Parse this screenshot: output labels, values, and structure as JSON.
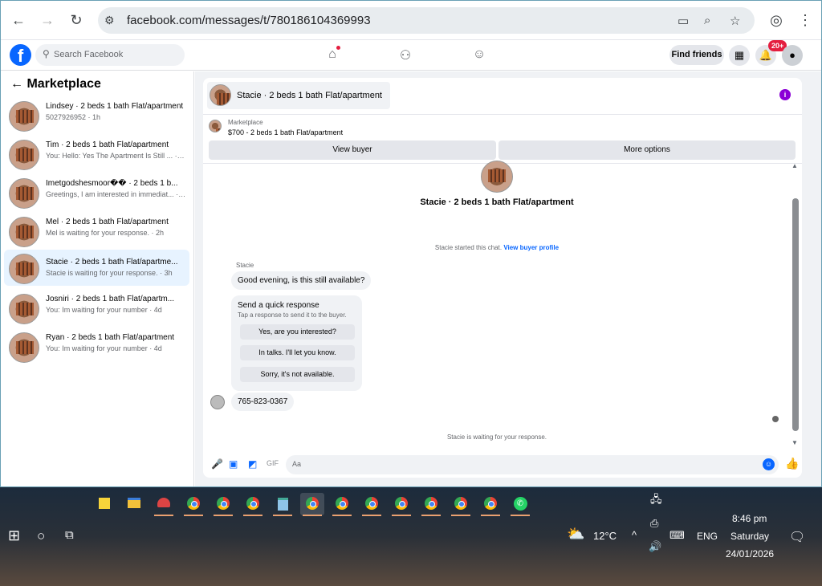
{
  "browser": {
    "url": "facebook.com/messages/t/780186104369993"
  },
  "header": {
    "logo": "f",
    "search_placeholder": "Search Facebook",
    "find_friends": "Find friends",
    "notif_badge": "20+"
  },
  "sidebar": {
    "title": "Marketplace",
    "items": [
      {
        "name": "Lindsey · 2 beds 1 bath Flat/apartment",
        "snippet": "5027926952 · 1h"
      },
      {
        "name": "Tim · 2 beds 1 bath Flat/apartment",
        "snippet": "You: Hello: Yes The Apartment Is Still ... · 1h"
      },
      {
        "name": "Imetgodshesmoor�� · 2 beds 1 b...",
        "snippet": "Greetings, I am interested in immediat... · 2h"
      },
      {
        "name": "Mel · 2 beds 1 bath Flat/apartment",
        "snippet": "Mel is waiting for your response. · 2h"
      },
      {
        "name": "Stacie · 2 beds 1 bath Flat/apartme...",
        "snippet": "Stacie is waiting for your response. · 3h"
      },
      {
        "name": "Josniri · 2 beds 1 bath Flat/apartm...",
        "snippet": "You: Im waiting for your number · 4d"
      },
      {
        "name": "Ryan · 2 beds 1 bath Flat/apartment",
        "snippet": "You: Im waiting for your number · 4d"
      }
    ]
  },
  "chat": {
    "title": "Stacie · 2 beds 1 bath Flat/apartment",
    "marketplace_label": "Marketplace",
    "listing": "$700 - 2 beds 1 bath Flat/apartment",
    "view_buyer": "View buyer",
    "more_options": "More options",
    "center_name": "Stacie · 2 beds 1 bath Flat/apartment",
    "started_text": "Stacie started this chat.",
    "view_profile": "View buyer profile",
    "sender": "Stacie",
    "message1": "Good evening, is this still available?",
    "quick_title": "Send a quick response",
    "quick_sub": "Tap a response to send it to the buyer.",
    "quick_1": "Yes, are you interested?",
    "quick_2": "In talks. I'll let you know.",
    "quick_3": "Sorry, it's not available.",
    "message2": "765-823-0367",
    "waiting": "Stacie is waiting for your response.",
    "input_placeholder": "Aa"
  },
  "taskbar": {
    "temp": "12°C",
    "lang": "ENG",
    "time": "8:46 pm",
    "day": "Saturday",
    "date": "24/01/2026"
  }
}
